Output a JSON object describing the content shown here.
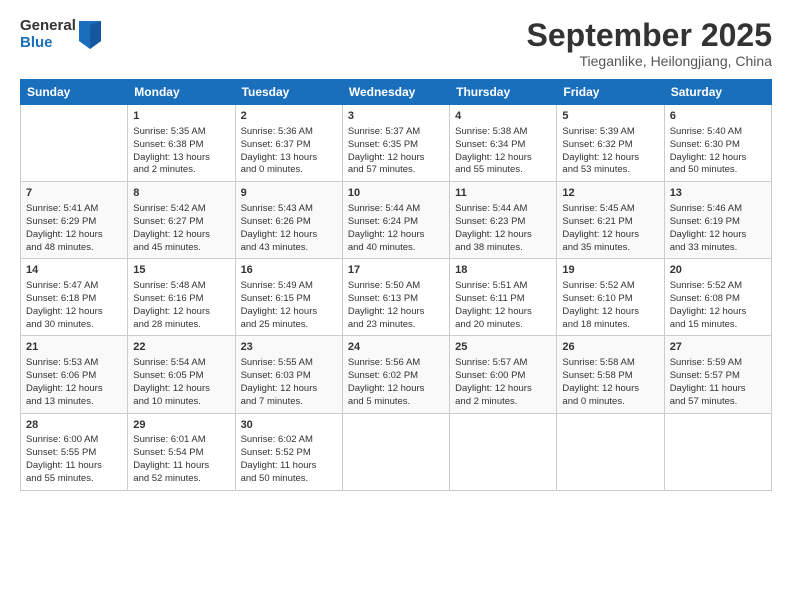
{
  "header": {
    "logo_general": "General",
    "logo_blue": "Blue",
    "month": "September 2025",
    "location": "Tieganlike, Heilongjiang, China"
  },
  "days_of_week": [
    "Sunday",
    "Monday",
    "Tuesday",
    "Wednesday",
    "Thursday",
    "Friday",
    "Saturday"
  ],
  "weeks": [
    [
      {
        "num": "",
        "info": ""
      },
      {
        "num": "1",
        "info": "Sunrise: 5:35 AM\nSunset: 6:38 PM\nDaylight: 13 hours\nand 2 minutes."
      },
      {
        "num": "2",
        "info": "Sunrise: 5:36 AM\nSunset: 6:37 PM\nDaylight: 13 hours\nand 0 minutes."
      },
      {
        "num": "3",
        "info": "Sunrise: 5:37 AM\nSunset: 6:35 PM\nDaylight: 12 hours\nand 57 minutes."
      },
      {
        "num": "4",
        "info": "Sunrise: 5:38 AM\nSunset: 6:34 PM\nDaylight: 12 hours\nand 55 minutes."
      },
      {
        "num": "5",
        "info": "Sunrise: 5:39 AM\nSunset: 6:32 PM\nDaylight: 12 hours\nand 53 minutes."
      },
      {
        "num": "6",
        "info": "Sunrise: 5:40 AM\nSunset: 6:30 PM\nDaylight: 12 hours\nand 50 minutes."
      }
    ],
    [
      {
        "num": "7",
        "info": "Sunrise: 5:41 AM\nSunset: 6:29 PM\nDaylight: 12 hours\nand 48 minutes."
      },
      {
        "num": "8",
        "info": "Sunrise: 5:42 AM\nSunset: 6:27 PM\nDaylight: 12 hours\nand 45 minutes."
      },
      {
        "num": "9",
        "info": "Sunrise: 5:43 AM\nSunset: 6:26 PM\nDaylight: 12 hours\nand 43 minutes."
      },
      {
        "num": "10",
        "info": "Sunrise: 5:44 AM\nSunset: 6:24 PM\nDaylight: 12 hours\nand 40 minutes."
      },
      {
        "num": "11",
        "info": "Sunrise: 5:44 AM\nSunset: 6:23 PM\nDaylight: 12 hours\nand 38 minutes."
      },
      {
        "num": "12",
        "info": "Sunrise: 5:45 AM\nSunset: 6:21 PM\nDaylight: 12 hours\nand 35 minutes."
      },
      {
        "num": "13",
        "info": "Sunrise: 5:46 AM\nSunset: 6:19 PM\nDaylight: 12 hours\nand 33 minutes."
      }
    ],
    [
      {
        "num": "14",
        "info": "Sunrise: 5:47 AM\nSunset: 6:18 PM\nDaylight: 12 hours\nand 30 minutes."
      },
      {
        "num": "15",
        "info": "Sunrise: 5:48 AM\nSunset: 6:16 PM\nDaylight: 12 hours\nand 28 minutes."
      },
      {
        "num": "16",
        "info": "Sunrise: 5:49 AM\nSunset: 6:15 PM\nDaylight: 12 hours\nand 25 minutes."
      },
      {
        "num": "17",
        "info": "Sunrise: 5:50 AM\nSunset: 6:13 PM\nDaylight: 12 hours\nand 23 minutes."
      },
      {
        "num": "18",
        "info": "Sunrise: 5:51 AM\nSunset: 6:11 PM\nDaylight: 12 hours\nand 20 minutes."
      },
      {
        "num": "19",
        "info": "Sunrise: 5:52 AM\nSunset: 6:10 PM\nDaylight: 12 hours\nand 18 minutes."
      },
      {
        "num": "20",
        "info": "Sunrise: 5:52 AM\nSunset: 6:08 PM\nDaylight: 12 hours\nand 15 minutes."
      }
    ],
    [
      {
        "num": "21",
        "info": "Sunrise: 5:53 AM\nSunset: 6:06 PM\nDaylight: 12 hours\nand 13 minutes."
      },
      {
        "num": "22",
        "info": "Sunrise: 5:54 AM\nSunset: 6:05 PM\nDaylight: 12 hours\nand 10 minutes."
      },
      {
        "num": "23",
        "info": "Sunrise: 5:55 AM\nSunset: 6:03 PM\nDaylight: 12 hours\nand 7 minutes."
      },
      {
        "num": "24",
        "info": "Sunrise: 5:56 AM\nSunset: 6:02 PM\nDaylight: 12 hours\nand 5 minutes."
      },
      {
        "num": "25",
        "info": "Sunrise: 5:57 AM\nSunset: 6:00 PM\nDaylight: 12 hours\nand 2 minutes."
      },
      {
        "num": "26",
        "info": "Sunrise: 5:58 AM\nSunset: 5:58 PM\nDaylight: 12 hours\nand 0 minutes."
      },
      {
        "num": "27",
        "info": "Sunrise: 5:59 AM\nSunset: 5:57 PM\nDaylight: 11 hours\nand 57 minutes."
      }
    ],
    [
      {
        "num": "28",
        "info": "Sunrise: 6:00 AM\nSunset: 5:55 PM\nDaylight: 11 hours\nand 55 minutes."
      },
      {
        "num": "29",
        "info": "Sunrise: 6:01 AM\nSunset: 5:54 PM\nDaylight: 11 hours\nand 52 minutes."
      },
      {
        "num": "30",
        "info": "Sunrise: 6:02 AM\nSunset: 5:52 PM\nDaylight: 11 hours\nand 50 minutes."
      },
      {
        "num": "",
        "info": ""
      },
      {
        "num": "",
        "info": ""
      },
      {
        "num": "",
        "info": ""
      },
      {
        "num": "",
        "info": ""
      }
    ]
  ]
}
